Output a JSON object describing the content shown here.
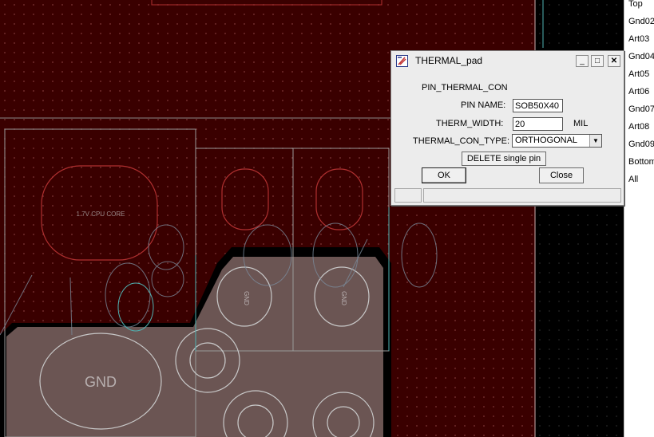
{
  "layers": [
    "Top",
    "Gnd02",
    "Art03",
    "Gnd04",
    "Art05",
    "Art06",
    "Gnd07",
    "Art08",
    "Gnd09",
    "Bottom",
    "All"
  ],
  "canvas": {
    "pad_labels": {
      "cpu_core": "1.7V CPU CORE",
      "gnd_large": "GND",
      "gnd_small_a": "GND",
      "gnd_small_b": "GND"
    },
    "colors": {
      "board": "#3a0000",
      "grid_dot": "#6e2a2a",
      "copper_fill": "#6b5553",
      "outline": "#b8b8b8",
      "teal": "#4fb3b3"
    }
  },
  "dialog": {
    "title": "THERMAL_pad",
    "section_label": "PIN_THERMAL_CON",
    "pin_name_label": "PIN NAME:",
    "pin_name_value": "SOB50X40",
    "therm_width_label": "THERM_WIDTH:",
    "therm_width_value": "20",
    "therm_width_unit": "MIL",
    "type_label": "THERMAL_CON_TYPE:",
    "type_value": "ORTHOGONAL",
    "delete_button": "DELETE single pin",
    "ok_button": "OK",
    "close_button": "Close",
    "minimize_glyph": "_",
    "maximize_glyph": "□",
    "close_glyph": "✕"
  }
}
